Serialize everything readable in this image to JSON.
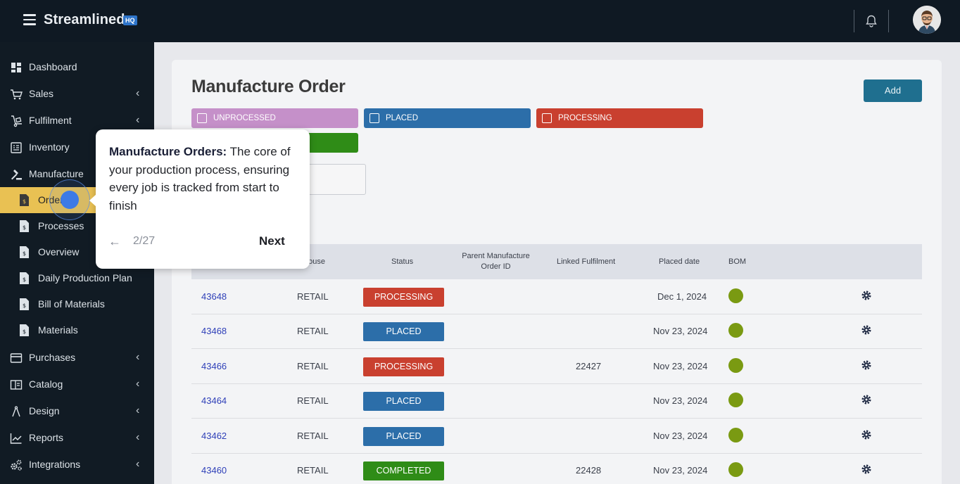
{
  "app": {
    "brand": "Streamlined",
    "badge": "HQ"
  },
  "sidebar": {
    "items": [
      {
        "label": "Dashboard",
        "icon": "dashboard-icon",
        "chevron": false
      },
      {
        "label": "Sales",
        "icon": "cart-icon",
        "chevron": true
      },
      {
        "label": "Fulfilment",
        "icon": "dolly-icon",
        "chevron": true
      },
      {
        "label": "Inventory",
        "icon": "inventory-icon",
        "chevron": false
      },
      {
        "label": "Manufacture",
        "icon": "gavel-icon",
        "chevron": false
      }
    ],
    "subitems": [
      {
        "label": "Orders",
        "icon": "file-dollar-icon",
        "active": true
      },
      {
        "label": "Processes",
        "icon": "file-dollar-icon"
      },
      {
        "label": "Overview",
        "icon": "file-dollar-icon"
      },
      {
        "label": "Daily Production Plan",
        "icon": "file-dollar-icon"
      },
      {
        "label": "Bill of Materials",
        "icon": "file-dollar-icon"
      },
      {
        "label": "Materials",
        "icon": "file-dollar-icon"
      }
    ],
    "items2": [
      {
        "label": "Purchases",
        "icon": "card-icon",
        "chevron": true
      },
      {
        "label": "Catalog",
        "icon": "catalog-icon",
        "chevron": true
      },
      {
        "label": "Design",
        "icon": "compass-icon",
        "chevron": true
      },
      {
        "label": "Reports",
        "icon": "chart-icon",
        "chevron": true
      },
      {
        "label": "Integrations",
        "icon": "cogs-icon",
        "chevron": true
      }
    ]
  },
  "main": {
    "title": "Manufacture Order",
    "add_label": "Add",
    "filters": [
      {
        "label": "UNPROCESSED",
        "color": "#c590c9"
      },
      {
        "label": "PLACED",
        "color": "#2c6ea9"
      },
      {
        "label": "PROCESSING",
        "color": "#c9402f"
      },
      {
        "label": "",
        "color": "#2f8c17"
      }
    ],
    "table": {
      "headers": [
        "house",
        "Status",
        "Parent Manufacture Order ID",
        "Linked Fulfilment",
        "Placed date",
        "BOM"
      ],
      "rows": [
        {
          "id": "43648",
          "warehouse": "RETAIL",
          "status": "PROCESSING",
          "fulfilment": "",
          "date": "Dec 1, 2024"
        },
        {
          "id": "43468",
          "warehouse": "RETAIL",
          "status": "PLACED",
          "fulfilment": "",
          "date": "Nov 23, 2024"
        },
        {
          "id": "43466",
          "warehouse": "RETAIL",
          "status": "PROCESSING",
          "fulfilment": "22427",
          "date": "Nov 23, 2024"
        },
        {
          "id": "43464",
          "warehouse": "RETAIL",
          "status": "PLACED",
          "fulfilment": "",
          "date": "Nov 23, 2024"
        },
        {
          "id": "43462",
          "warehouse": "RETAIL",
          "status": "PLACED",
          "fulfilment": "",
          "date": "Nov 23, 2024"
        },
        {
          "id": "43460",
          "warehouse": "RETAIL",
          "status": "COMPLETED",
          "fulfilment": "22428",
          "date": "Nov 23, 2024"
        }
      ]
    },
    "status_colors": {
      "PROCESSING": "#c9402f",
      "PLACED": "#2c6ea9",
      "COMPLETED": "#2f8c17"
    }
  },
  "tour": {
    "title": "Manufacture Orders:",
    "body": "The core of your production process, ensuring every job is tracked from start to finish",
    "back": "←",
    "counter": "2/27",
    "next": "Next"
  }
}
